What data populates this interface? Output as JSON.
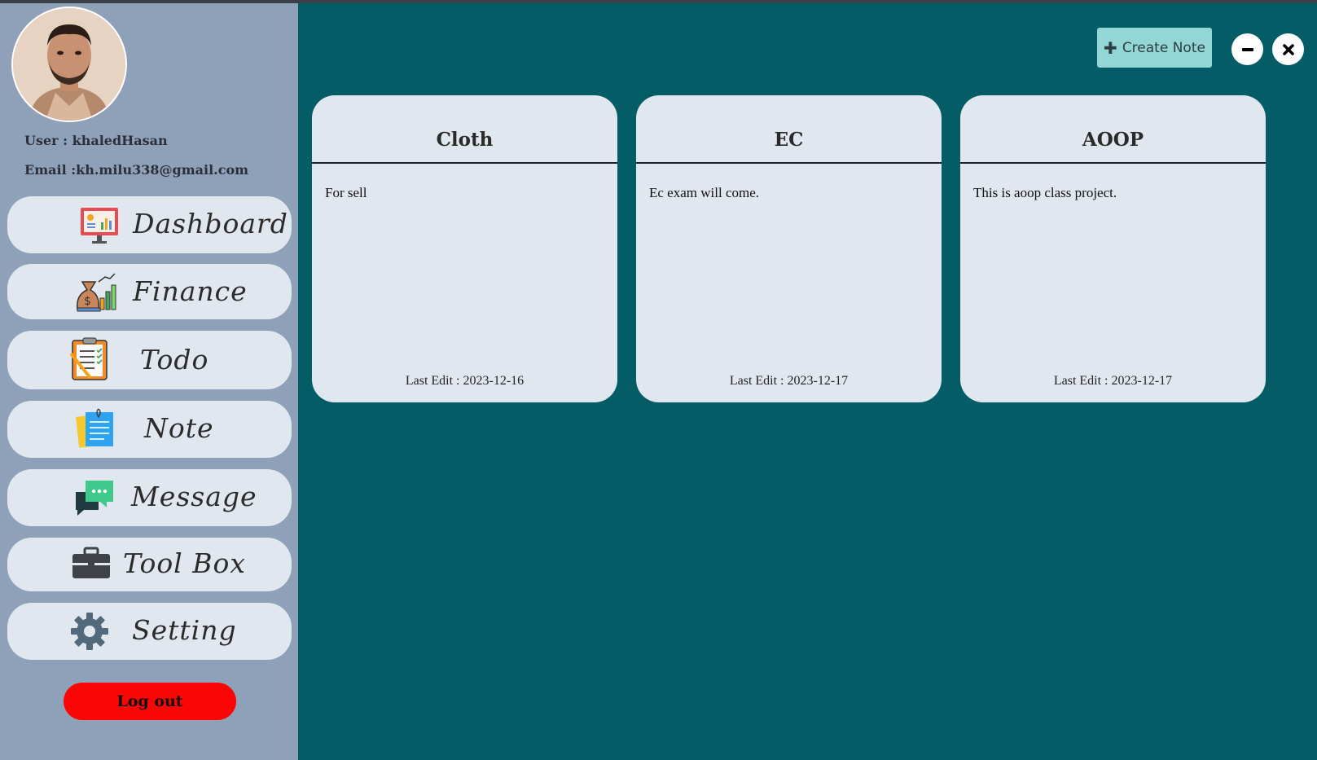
{
  "user": {
    "name_line": "User : khaledHasan",
    "email_line": "Email :kh.milu338@gmail.com"
  },
  "sidebar": {
    "items": [
      {
        "label": "Dashboard",
        "icon": "dashboard-icon"
      },
      {
        "label": "Finance",
        "icon": "finance-icon"
      },
      {
        "label": "Todo",
        "icon": "todo-clipboard-icon"
      },
      {
        "label": "Note",
        "icon": "sticky-note-icon"
      },
      {
        "label": "Message",
        "icon": "message-bubble-icon"
      },
      {
        "label": "Tool Box",
        "icon": "toolbox-icon"
      },
      {
        "label": "Setting",
        "icon": "gear-icon"
      }
    ],
    "logout_label": "Log out"
  },
  "toolbar": {
    "create_label": "Create Note"
  },
  "notes": [
    {
      "title": "Cloth",
      "body": "For sell",
      "last_edit": "Last Edit : 2023-12-16"
    },
    {
      "title": "EC",
      "body": "Ec exam will come.",
      "last_edit": "Last Edit : 2023-12-17"
    },
    {
      "title": "AOOP",
      "body": "This is aoop class project.",
      "last_edit": "Last Edit : 2023-12-17"
    }
  ],
  "colors": {
    "background": "#045d66",
    "sidebar": "#8fa1b9",
    "card": "#e1e7ee",
    "create_button": "#93d6d6",
    "logout_button": "#fa0606"
  }
}
